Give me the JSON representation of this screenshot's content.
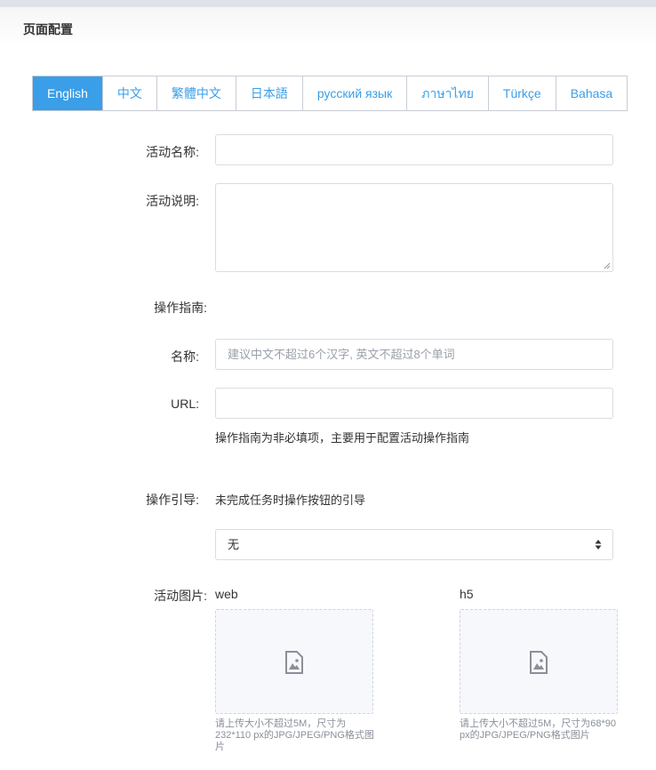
{
  "page": {
    "title": "页面配置"
  },
  "tabs": [
    {
      "label": "English",
      "active": true
    },
    {
      "label": "中文"
    },
    {
      "label": "繁體中文"
    },
    {
      "label": "日本語"
    },
    {
      "label": "русский язык"
    },
    {
      "label": "ภาษาไทย"
    },
    {
      "label": "Türkçe"
    },
    {
      "label": "Bahasa"
    }
  ],
  "form": {
    "activity_name_label": "活动名称:",
    "activity_name_value": "",
    "activity_desc_label": "活动说明:",
    "activity_desc_value": "",
    "guide_section_label": "操作指南:",
    "guide_name_label": "名称:",
    "guide_name_placeholder": "建议中文不超过6个汉字, 英文不超过8个单词",
    "guide_url_label": "URL:",
    "guide_url_value": "",
    "guide_hint": "操作指南为非必填项，主要用于配置活动操作指南",
    "lead_label": "操作引导:",
    "lead_hint": "未完成任务时操作按钮的引导",
    "lead_select_value": "无",
    "image_label": "活动图片:"
  },
  "uploads": {
    "web": {
      "title": "web",
      "note": "请上传大小不超过5M，尺寸为232*110 px的JPG/JPEG/PNG格式图片"
    },
    "h5": {
      "title": "h5",
      "note": "请上传大小不超过5M，尺寸为68*90 px的JPG/JPEG/PNG格式图片"
    }
  },
  "colors": {
    "accent": "#3a9ee8",
    "border": "#d9dce2"
  },
  "icons": {
    "upload": "image-placeholder-icon",
    "select": "sort-arrows-icon"
  }
}
